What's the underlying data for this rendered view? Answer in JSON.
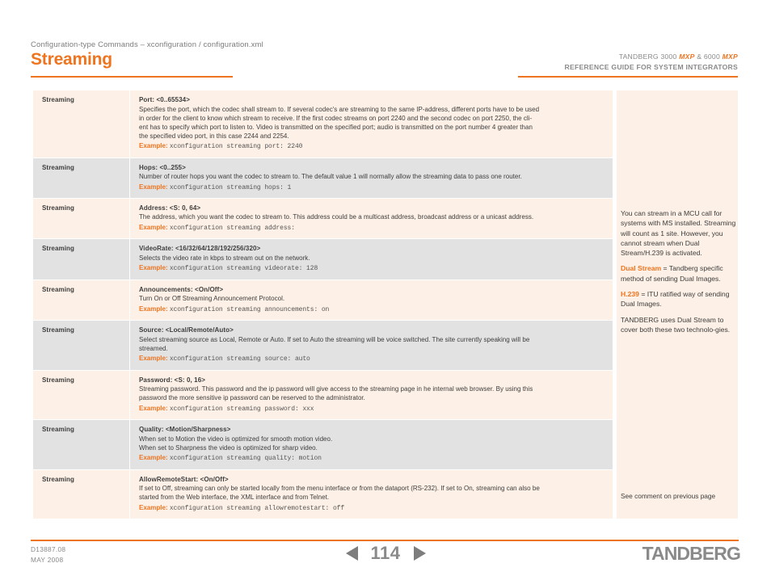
{
  "header": {
    "breadcrumb": "Configuration-type Commands – xconfiguration / configuration.xml",
    "page_title": "Streaming",
    "product_line_prefix": "TANDBERG 3000 ",
    "product_mxp_1": "MXP",
    "product_line_mid": " & 6000 ",
    "product_mxp_2": "MXP",
    "guide_subtitle": "REFERENCE GUIDE FOR SYSTEM INTEGRATORS",
    "accent_color": "#ee7420"
  },
  "table": {
    "rows": [
      {
        "name": "Streaming",
        "signature": "Port: <0..65534>",
        "description": [
          "Specifies the port, which the codec shall stream to. If several codec's are streaming to the same IP-address, different ports have to be used",
          "in order for the client to know which stream to receive. If the first codec streams on port 2240 and the second codec on port 2250, the cli-",
          "ent has to specify which port to listen to. Video is transmitted on the specified port; audio is transmitted on the port number 4 greater than",
          "the specified video port, in this case 2244 and 2254."
        ],
        "example_label": "Example:",
        "example_code": "xconfiguration streaming port: 2240"
      },
      {
        "name": "Streaming",
        "signature": "Hops: <0..255>",
        "description": [
          "Number of router hops you want the codec to stream to. The default value 1 will normally allow the streaming data to pass one router."
        ],
        "example_label": "Example:",
        "example_code": "xconfiguration streaming hops: 1"
      },
      {
        "name": "Streaming",
        "signature": "Address: <S: 0, 64>",
        "description": [
          "The address, which you want the codec to stream to. This address could be a multicast address, broadcast address or a unicast address."
        ],
        "example_label": "Example:",
        "example_code": "xconfiguration streaming address:"
      },
      {
        "name": "Streaming",
        "signature": "VideoRate: <16/32/64/128/192/256/320>",
        "description": [
          "Selects the video rate in kbps to stream out on the network."
        ],
        "example_label": "Example:",
        "example_code": "xconfiguration streaming videorate: 128"
      },
      {
        "name": "Streaming",
        "signature": "Announcements: <On/Off>",
        "description": [
          "Turn On or Off Streaming Announcement Protocol."
        ],
        "example_label": "Example:",
        "example_code": "xconfiguration streaming announcements: on"
      },
      {
        "name": "Streaming",
        "signature": "Source: <Local/Remote/Auto>",
        "description": [
          "Select streaming source as Local, Remote or Auto. If set to Auto the streaming will be voice switched. The site currently speaking will be",
          "streamed."
        ],
        "example_label": "Example:",
        "example_code": "xconfiguration streaming source: auto"
      },
      {
        "name": "Streaming",
        "signature": "Password: <S: 0, 16>",
        "description": [
          "Streaming password. This password and the ip password will give access to the streaming page in he internal web browser. By using this",
          "password the more sensitive ip password can be reserved to the administrator."
        ],
        "example_label": "Example:",
        "example_code": "xconfiguration streaming password: xxx"
      },
      {
        "name": "Streaming",
        "signature": "Quality: <Motion/Sharpness>",
        "description": [
          "When set to Motion the video is optimized for smooth motion video.",
          "When set to Sharpness the video is optimized for sharp video."
        ],
        "example_label": "Example:",
        "example_code": "xconfiguration streaming quality: motion"
      },
      {
        "name": "Streaming",
        "signature": "AllowRemoteStart: <On/Off>",
        "description": [
          "If set to Off, streaming can only be started locally from the menu interface or from the dataport (RS-232). If set to On, streaming can also be",
          "started from the Web interface, the XML interface and from Telnet."
        ],
        "example_label": "Example:",
        "example_code": "xconfiguration streaming allowremotestart: off"
      }
    ]
  },
  "note_panel": {
    "paragraph_1": "You can stream in a MCU call for systems with MS installed. Streaming will count as 1 site. However, you cannot stream when Dual Stream/H.239 is activated.",
    "term_dual_stream": "Dual Stream",
    "dual_stream_definition": " = Tandberg specific method of sending Dual Images.",
    "term_h239": "H.239",
    "h239_definition": " = ITU ratified way of sending Dual Images.",
    "paragraph_final": "TANDBERG uses Dual Stream to cover both these two technolo-gies.",
    "see_previous_page": "See comment on previous page"
  },
  "footer": {
    "doc_id": "D13887.08",
    "doc_date": "MAY 2008",
    "page_number": "114",
    "prev_arrow": "prev-page-arrow",
    "next_arrow": "next-page-arrow",
    "brand": "TANDBERG"
  }
}
